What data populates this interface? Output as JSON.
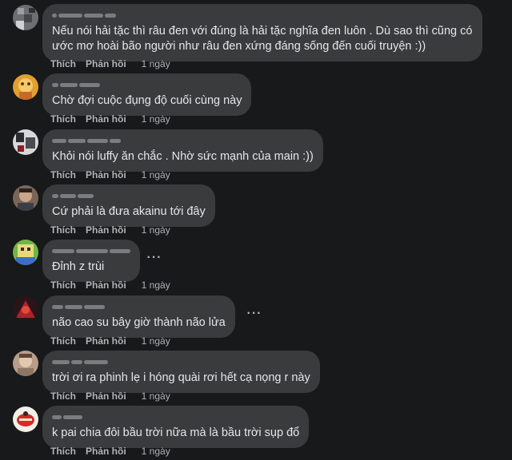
{
  "comments": [
    {
      "text": "Nếu nói hải tặc thì râu đen với đúng là hải tặc nghĩa đen luôn . Dù sao thì cũng có ước mơ hoài bão người như râu đen xứng đáng sống đến cuối truyện :))",
      "like": "Thích",
      "reply": "Phản hồi",
      "time": "1 ngày"
    },
    {
      "text": "Chờ đợi cuộc đụng độ cuối cùng này",
      "like": "Thích",
      "reply": "Phản hồi",
      "time": "1 ngày"
    },
    {
      "text": "Khỏi nói luffy ăn chắc . Nhờ sức mạnh của main :))",
      "like": "Thích",
      "reply": "Phản hồi",
      "time": "1 ngày"
    },
    {
      "text": "Cứ phải là đưa akainu tới đây",
      "like": "Thích",
      "reply": "Phản hồi",
      "time": "1 ngày"
    },
    {
      "text": "Đỉnh z trùi",
      "like": "Thích",
      "reply": "Phản hồi",
      "time": "1 ngày"
    },
    {
      "text": "não cao su bây giờ thành não lửa",
      "like": "Thích",
      "reply": "Phản hồi",
      "time": "1 ngày"
    },
    {
      "text": "trời ơi ra phinh lẹ i hóng quài rơi hết cạ nọng r này",
      "like": "Thích",
      "reply": "Phản hồi",
      "time": "1 ngày"
    },
    {
      "text": "k pai chia đôi bầu trời nữa mà là bầu trời sụp đổ",
      "like": "Thích",
      "reply": "Phản hồi",
      "time": "1 ngày"
    }
  ],
  "icons": {
    "more": "more-options-icon",
    "avatar": "avatar"
  },
  "colors": {
    "background": "#18191a",
    "bubble": "#3a3b3c",
    "text": "#e4e6eb",
    "secondary": "#b0b3b8"
  }
}
